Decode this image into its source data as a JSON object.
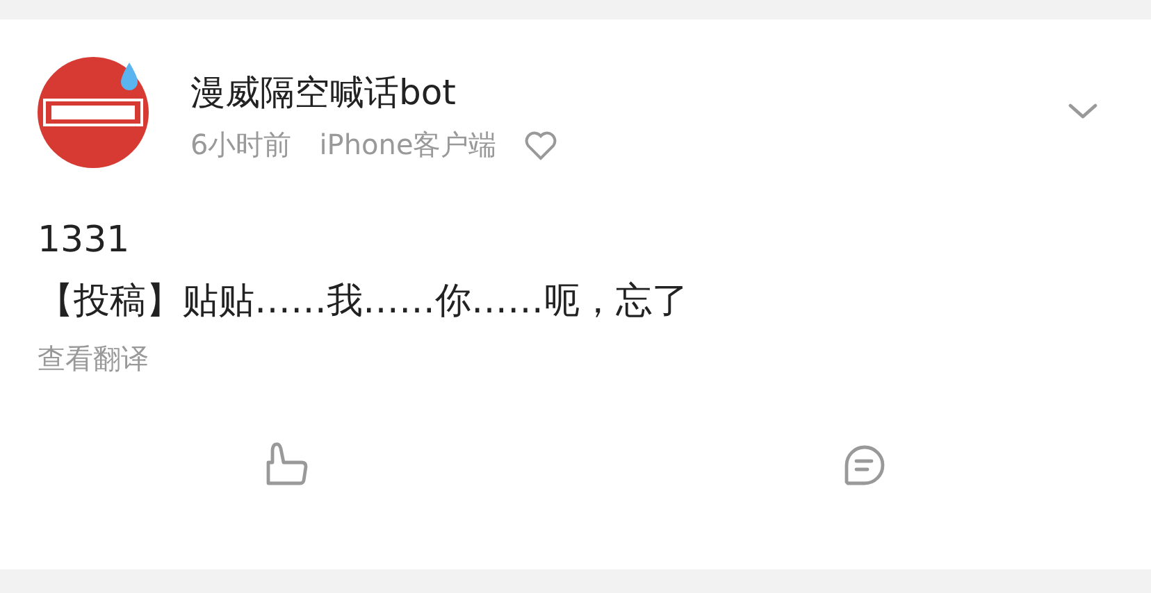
{
  "post": {
    "author": "漫威隔空喊话bot",
    "time": "6小时前",
    "source": "iPhone客户端",
    "text_lines": [
      "1331",
      "【投稿】贴贴……我……你……呃，忘了"
    ],
    "translate_link": "查看翻译",
    "actions": [
      {
        "kind": "like"
      },
      {
        "kind": "comment"
      }
    ]
  }
}
